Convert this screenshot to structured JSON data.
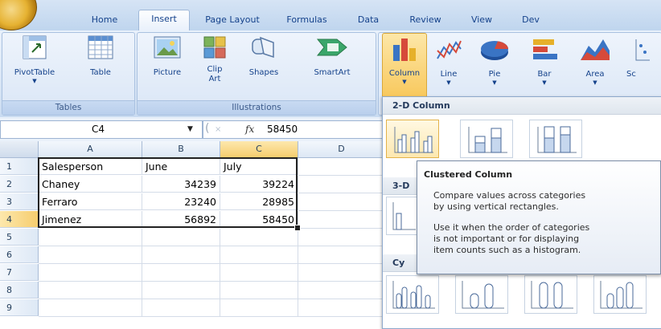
{
  "tabs": [
    "Home",
    "Insert",
    "Page Layout",
    "Formulas",
    "Data",
    "Review",
    "View",
    "Dev"
  ],
  "active_tab": "Insert",
  "ribbon": {
    "tables": {
      "label": "Tables",
      "pivot": "PivotTable",
      "table": "Table"
    },
    "illustrations": {
      "label": "Illustrations",
      "picture": "Picture",
      "clip_line1": "Clip",
      "clip_line2": "Art",
      "shapes": "Shapes",
      "smartart": "SmartArt"
    },
    "charts": {
      "column": "Column",
      "line": "Line",
      "pie": "Pie",
      "bar": "Bar",
      "area": "Area",
      "scatter": "Sc"
    }
  },
  "formula_bar": {
    "cell_ref": "C4",
    "fx": "fx",
    "value": "58450"
  },
  "grid": {
    "columns": [
      "A",
      "B",
      "C",
      "D"
    ],
    "rows": [
      "1",
      "2",
      "3",
      "4",
      "5",
      "6",
      "7",
      "8",
      "9"
    ],
    "cells": [
      [
        "Salesperson",
        "June",
        "July"
      ],
      [
        "Chaney",
        "34239",
        "39224"
      ],
      [
        "Ferraro",
        "23240",
        "28985"
      ],
      [
        "Jimenez",
        "56892",
        "58450"
      ]
    ]
  },
  "dropdown": {
    "sec_2d": "2-D Column",
    "sec_3d": "3-D",
    "sec_cyl": "Cy"
  },
  "tooltip": {
    "title": "Clustered Column",
    "line1": "Compare values across categories",
    "line2": "by using vertical rectangles.",
    "line3": "Use it when the order of categories",
    "line4": "is not important or for displaying",
    "line5": "item counts such as a histogram."
  },
  "colors": {
    "accent": "#15428b",
    "selection": "#f6cd6e"
  }
}
